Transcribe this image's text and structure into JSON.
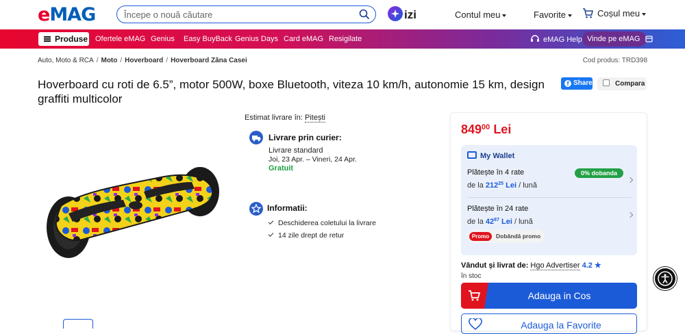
{
  "header": {
    "logo_e": "e",
    "logo_mag": "MAG",
    "search_placeholder": "Începe o nouă căutare",
    "izi_label": "izi",
    "account": "Contul meu",
    "favorites": "Favorite",
    "cart": "Coșul meu"
  },
  "navbar": {
    "products": "Produse",
    "items": [
      "Ofertele eMAG",
      "Genius",
      "Easy BuyBack",
      "Genius Days",
      "Card eMAG",
      "Resigilate"
    ],
    "help": "eMAG Help",
    "sell": "Vinde pe eMAG"
  },
  "breadcrumb": {
    "items": [
      "Auto, Moto & RCA",
      "Moto",
      "Hoverboard",
      "Hoverboard Zâna Casei"
    ],
    "product_code": "Cod produs: TRD398"
  },
  "product": {
    "title": "Hoverboard cu roti de 6.5”, motor 500W, boxe Bluetooth, viteza 10 km/h, autonomie 15 km, design graffiti multicolor",
    "share": "Share",
    "compare": "Compara"
  },
  "delivery": {
    "estimate_label": "Estimat livrare în:",
    "city": "Pitești",
    "courier_title": "Livrare prin curier:",
    "standard": "Livrare standard",
    "dates": "Joi, 23 Apr. – Vineri, 24 Apr.",
    "cost": "Gratuit",
    "info_title": "Informatii:",
    "info_items": [
      "Deschiderea coletului la livrare",
      "14 zile drept de retur"
    ]
  },
  "buy": {
    "price_main": "849",
    "price_cents": "00",
    "currency": "Lei",
    "wallet_title": "My Wallet",
    "rate4_title": "Plătește în 4 rate",
    "rate4_prefix": "de la",
    "rate4_amount": "212",
    "rate4_cents": "25",
    "rate4_currency": "Lei",
    "rate4_suffix": "/ lună",
    "zero_interest": "0% dobanda",
    "rate24_title": "Plătește în 24 rate",
    "rate24_prefix": "de la",
    "rate24_amount": "42",
    "rate24_cents": "87",
    "rate24_currency": "Lei",
    "rate24_suffix": "/ lună",
    "promo_tag": "Promo",
    "promo_text": "Dobândă promo",
    "seller_label": "Vândut și livrat de:",
    "seller_name": "Hgo Advertiser",
    "seller_rating": "4.2 ★",
    "stock": "în stoc",
    "add_to_cart": "Adauga in Cos",
    "add_to_favorites": "Adauga la Favorite"
  },
  "colors": {
    "brand_red": "#e0141e",
    "brand_blue": "#1c5bd8",
    "free_green": "#22a043"
  }
}
